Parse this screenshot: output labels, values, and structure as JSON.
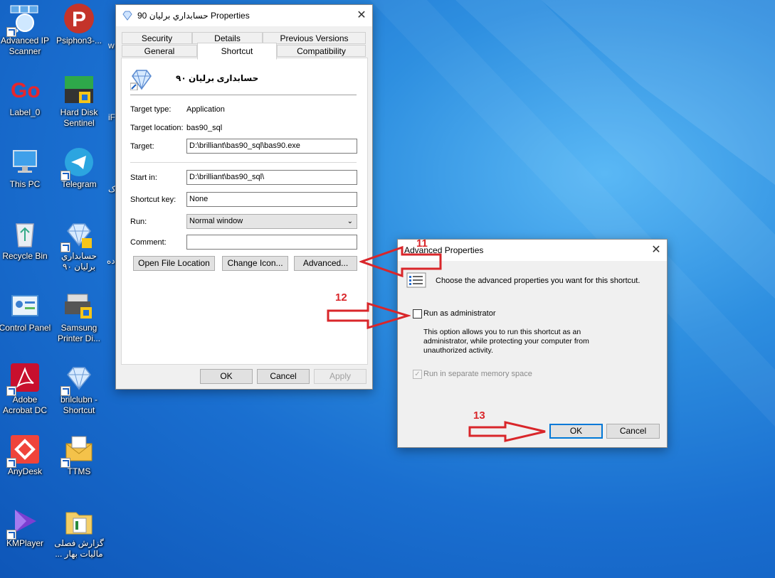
{
  "desktop": {
    "icons": [
      {
        "label": "Advanced IP Scanner"
      },
      {
        "label": "Label_0"
      },
      {
        "label": "This PC"
      },
      {
        "label": "Recycle Bin"
      },
      {
        "label": "Control Panel"
      },
      {
        "label": "Adobe Acrobat DC"
      },
      {
        "label": "AnyDesk"
      },
      {
        "label": "KMPlayer"
      },
      {
        "label": "Psiphon3-..."
      },
      {
        "label": "Hard Disk Sentinel"
      },
      {
        "label": "Telegram"
      },
      {
        "label": "حسابداري برليان ۹۰"
      },
      {
        "label": "Samsung Printer Di..."
      },
      {
        "label": "brilclubn - Shortcut"
      },
      {
        "label": "TTMS"
      },
      {
        "label": "گزارش فصلی مالیات بهار ..."
      }
    ],
    "edge_glyphs": [
      "w",
      "iF",
      "ک",
      "ده"
    ],
    "colors": {
      "accent": "#0078d7",
      "annotation": "#d9262a"
    }
  },
  "properties": {
    "title": "حسابداري برليان 90 Properties",
    "tabs_top": [
      "Security",
      "Details",
      "Previous Versions"
    ],
    "tabs_bottom": [
      "General",
      "Shortcut",
      "Compatibility"
    ],
    "active_tab": "Shortcut",
    "shortcut_name": "حسابداری برلیان ۹۰",
    "target_type_label": "Target type:",
    "target_type": "Application",
    "target_location_label": "Target location:",
    "target_location": "bas90_sql",
    "target_label": "Target:",
    "target": "D:\\brilliant\\bas90_sql\\bas90.exe",
    "start_in_label": "Start in:",
    "start_in": "D:\\brilliant\\bas90_sql\\",
    "shortcut_key_label": "Shortcut key:",
    "shortcut_key": "None",
    "run_label": "Run:",
    "run": "Normal window",
    "comment_label": "Comment:",
    "comment": "",
    "open_file_location": "Open File Location",
    "change_icon": "Change Icon...",
    "advanced": "Advanced...",
    "ok": "OK",
    "cancel": "Cancel",
    "apply": "Apply"
  },
  "advanced": {
    "title": "Advanced Properties",
    "description": "Choose the advanced properties you want for this shortcut.",
    "run_as_admin": "Run as administrator",
    "run_as_admin_checked": false,
    "help_text": "This option allows you to run this shortcut as an administrator, while protecting your computer from unauthorized activity.",
    "separate_memory": "Run in separate memory space",
    "separate_memory_checked": true,
    "ok": "OK",
    "cancel": "Cancel"
  },
  "annotations": {
    "step11": "11",
    "step12": "12",
    "step13": "13"
  }
}
